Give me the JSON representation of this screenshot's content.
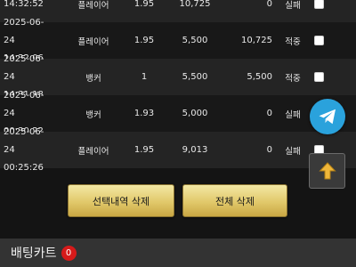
{
  "bet_history": {
    "rows": [
      {
        "date": "",
        "time": "14:32:52",
        "bet": "플레이어",
        "odds": "1.95",
        "amount": "10,725",
        "win": "0",
        "result": "실패"
      },
      {
        "date": "2025-06-24",
        "time": "14:32:06",
        "bet": "플레이어",
        "odds": "1.95",
        "amount": "5,500",
        "win": "10,725",
        "result": "적중"
      },
      {
        "date": "2025-06-24",
        "time": "14:31:18",
        "bet": "뱅커",
        "odds": "1",
        "amount": "5,500",
        "win": "5,500",
        "result": "적중"
      },
      {
        "date": "2025-06-24",
        "time": "00:30:22",
        "bet": "뱅커",
        "odds": "1.93",
        "amount": "5,000",
        "win": "0",
        "result": "실패"
      },
      {
        "date": "2025-06-24",
        "time": "00:25:26",
        "bet": "플레이어",
        "odds": "1.95",
        "amount": "9,013",
        "win": "0",
        "result": "실패"
      }
    ]
  },
  "actions": {
    "delete_selected_label": "선택내역 삭제",
    "delete_all_label": "전체 삭제"
  },
  "floating": {
    "telegram_icon": "telegram-icon",
    "scroll_top_icon": "arrow-up-icon"
  },
  "bet_cart": {
    "title": "배팅카트",
    "count": "0"
  },
  "colors": {
    "gold": "#e1c86a",
    "telegram": "#2aa2dc",
    "badge": "#d61a1a"
  }
}
